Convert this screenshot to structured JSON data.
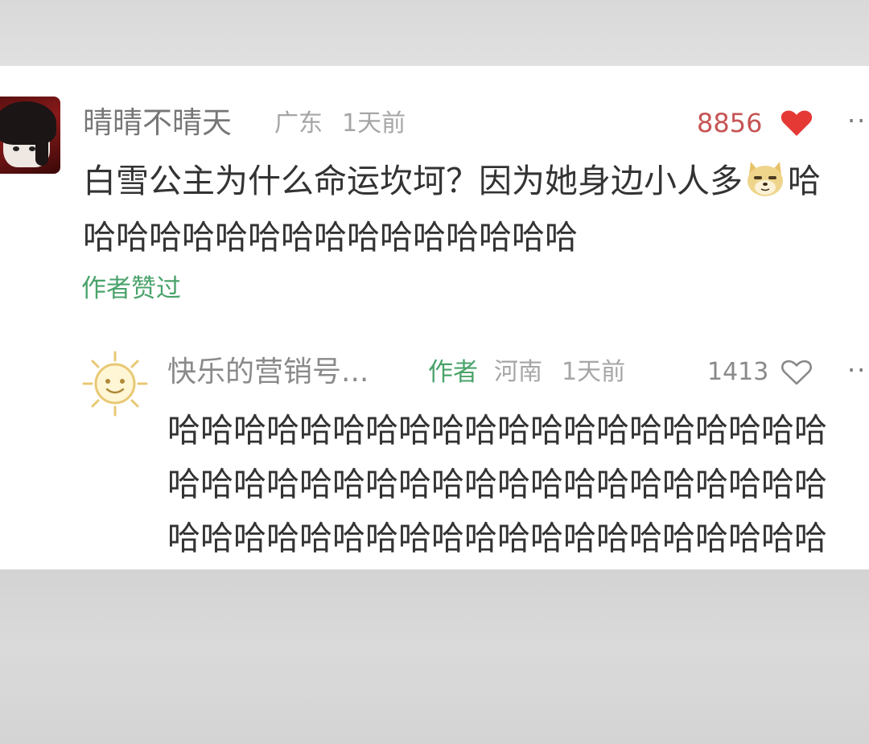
{
  "comment": {
    "user_name": "晴晴不晴天",
    "location": "广东",
    "time": "1天前",
    "like_count": "8856",
    "liked": true,
    "text_line1_before_emoji": "白雪公主为什么命运坎坷？因为她身边小人多",
    "emoji": "doge-emoji",
    "text_line1_after_emoji": "哈",
    "text_line2": "哈哈哈哈哈哈哈哈哈哈哈哈哈哈哈",
    "author_liked_label": "作者赞过"
  },
  "reply": {
    "user_name": "快乐的营销号...",
    "author_badge": "作者",
    "location": "河南",
    "time": "1天前",
    "like_count": "1413",
    "liked": false,
    "text_lines": [
      "哈哈哈哈哈哈哈哈哈哈哈哈哈哈哈哈哈哈哈哈",
      "哈哈哈哈哈哈哈哈哈哈哈哈哈哈哈哈哈哈哈哈",
      "哈哈哈哈哈哈哈哈哈哈哈哈哈哈哈哈哈哈哈哈"
    ]
  },
  "colors": {
    "liked_heart": "#e53935",
    "like_count_active": "#c75454",
    "author_green": "#4aa36b",
    "meta_gray": "#a6a6a6"
  },
  "icons": {
    "more": "more-icon",
    "heart_filled": "heart-filled-icon",
    "heart_outline": "heart-outline-icon",
    "sun_avatar": "sun-avatar-icon"
  }
}
